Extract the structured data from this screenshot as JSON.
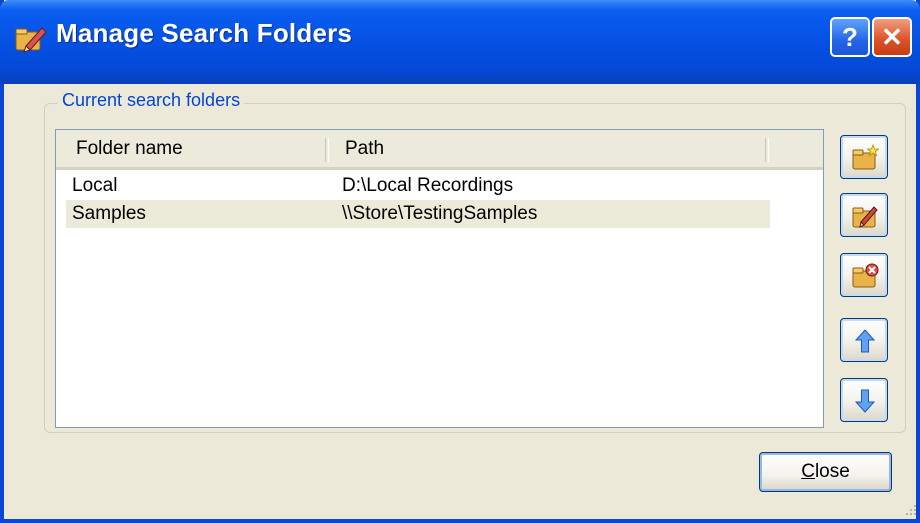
{
  "window": {
    "title": "Manage Search Folders"
  },
  "titlebar": {
    "help_glyph": "?",
    "close_glyph": "✕"
  },
  "group": {
    "label": "Current search folders"
  },
  "list": {
    "columns": [
      "Folder name",
      "Path"
    ],
    "rows": [
      {
        "name": "Local",
        "path": "D:\\Local Recordings"
      },
      {
        "name": "Samples",
        "path": "\\\\Store\\TestingSamples"
      }
    ]
  },
  "side_buttons": [
    {
      "icon": "new-folder-icon"
    },
    {
      "icon": "edit-folder-icon"
    },
    {
      "icon": "delete-folder-icon"
    },
    {
      "icon": "move-up-icon"
    },
    {
      "icon": "move-down-icon"
    }
  ],
  "footer": {
    "close_access_key": "C",
    "close_rest": "lose"
  }
}
